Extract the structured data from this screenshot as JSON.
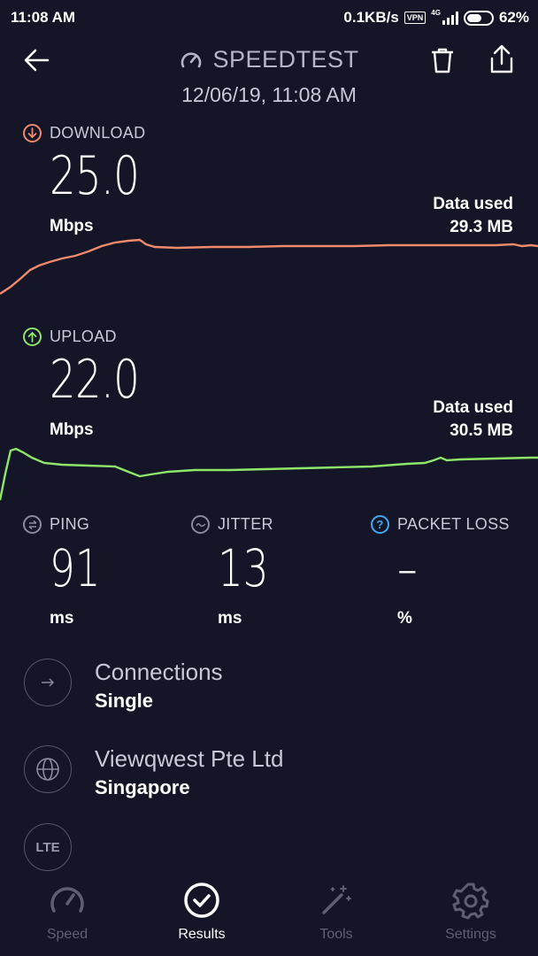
{
  "status_bar": {
    "time": "11:08 AM",
    "speed": "0.1KB/s",
    "vpn": "VPN",
    "network": "4G",
    "battery": "62%",
    "battery_level": 0.62
  },
  "header": {
    "title": "SPEEDTEST",
    "datetime": "12/06/19, 11:08 AM"
  },
  "download": {
    "label": "DOWNLOAD",
    "value": "25.0",
    "unit": "Mbps",
    "data_used_label": "Data used",
    "data_used_value": "29.3 MB",
    "color": "#f08a6c"
  },
  "upload": {
    "label": "UPLOAD",
    "value": "22.0",
    "unit": "Mbps",
    "data_used_label": "Data used",
    "data_used_value": "30.5 MB",
    "color": "#8ee66a"
  },
  "ping": {
    "label": "PING",
    "value": "91",
    "unit": "ms"
  },
  "jitter": {
    "label": "JITTER",
    "value": "13",
    "unit": "ms"
  },
  "packet_loss": {
    "label": "PACKET LOSS",
    "value": "–",
    "unit": "%",
    "color": "#3fa9f5"
  },
  "connections": {
    "title": "Connections",
    "value": "Single"
  },
  "provider": {
    "title": "Viewqwest Pte Ltd",
    "value": "Singapore"
  },
  "network_badge": "LTE",
  "nav": {
    "speed": "Speed",
    "results": "Results",
    "tools": "Tools",
    "settings": "Settings"
  }
}
